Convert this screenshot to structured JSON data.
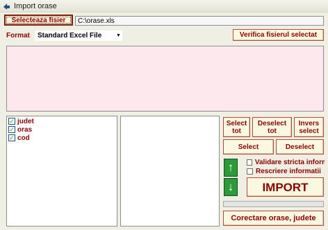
{
  "window": {
    "title": "Import orase",
    "icon": "app-arrow-icon"
  },
  "file": {
    "button_label": "Selecteaza fisier",
    "path": "C:\\orase.xls"
  },
  "format": {
    "label": "Format",
    "selected": "Standard Excel File",
    "verify_label": "Verifica fisierul selectat"
  },
  "columns": [
    {
      "label": "judet",
      "checked": true
    },
    {
      "label": "oras",
      "checked": true
    },
    {
      "label": "cod",
      "checked": true
    }
  ],
  "buttons": {
    "select_all": "Select tot",
    "deselect_all": "Deselect tot",
    "invert": "Invers select",
    "select": "Select",
    "deselect": "Deselect",
    "move_up": "arrow-up-icon",
    "move_down": "arrow-down-icon",
    "import": "IMPORT",
    "fix_cities": "Corectare orase, judete"
  },
  "options": {
    "strict_validation": "Validare stricta informatii",
    "overwrite": "Rescriere informatii"
  },
  "progress": 0,
  "colors": {
    "accent": "#8a0000",
    "button_bg": "#fbf8e2",
    "preview_bg": "#fde8ee",
    "arrow_green": "#2c9a38"
  }
}
